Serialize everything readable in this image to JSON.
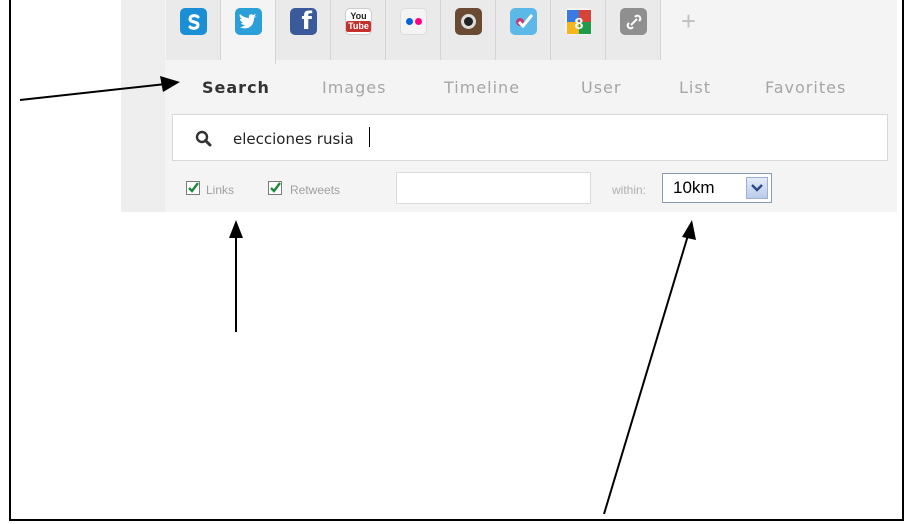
{
  "services": [
    {
      "name": "skype-tab",
      "icon": "skype-icon",
      "color": "#1a8fd6",
      "glyph": "S"
    },
    {
      "name": "twitter-tab",
      "icon": "twitter-icon",
      "color": "#2a9fd8",
      "glyph": ""
    },
    {
      "name": "facebook-tab",
      "icon": "facebook-icon",
      "color": "#3b5a9a",
      "glyph": "f"
    },
    {
      "name": "youtube-tab",
      "icon": "youtube-icon",
      "color": "#c4302b",
      "glyph_top": "You",
      "glyph_bottom": "Tube"
    },
    {
      "name": "flickr-tab",
      "icon": "flickr-icon",
      "color": "#ffffff",
      "glyph": ""
    },
    {
      "name": "instagram-tab",
      "icon": "instagram-icon",
      "color": "#6b4a33",
      "glyph": ""
    },
    {
      "name": "foursquare-tab",
      "icon": "foursquare-icon",
      "color": "#4fb3e3",
      "glyph": ""
    },
    {
      "name": "google-tab",
      "icon": "google-icon",
      "color": "#ffffff",
      "glyph": ""
    },
    {
      "name": "link-tab",
      "icon": "link-icon",
      "color": "#8f8f8f",
      "glyph": ""
    },
    {
      "name": "add-tab",
      "icon": "plus-icon",
      "color": "#c0c0c0",
      "glyph": "+"
    }
  ],
  "subtabs": [
    "Search",
    "Images",
    "Timeline",
    "User",
    "List",
    "Favorites"
  ],
  "search": {
    "value": "elecciones rusia",
    "icon": "search-icon"
  },
  "options": {
    "links_label": "Links",
    "retweets_label": "Retweets",
    "links_checked": true,
    "retweets_checked": true,
    "location_value": "",
    "within_label": "within:",
    "range_value": "10km"
  }
}
